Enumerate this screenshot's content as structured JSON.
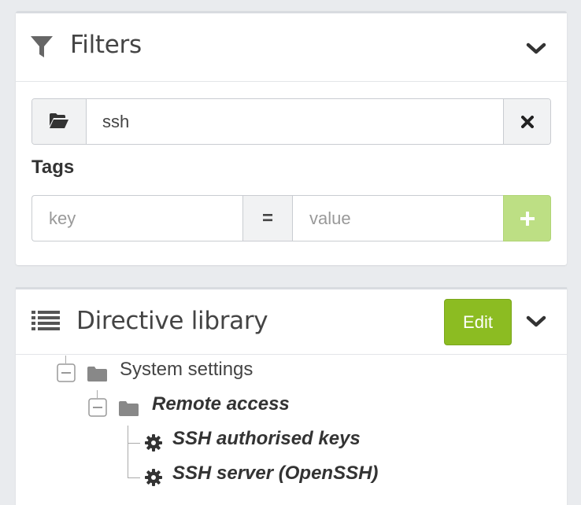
{
  "filters": {
    "title": "Filters",
    "search": {
      "value": "ssh"
    },
    "tags": {
      "label": "Tags",
      "key_placeholder": "key",
      "operator": "=",
      "value_placeholder": "value"
    }
  },
  "library": {
    "title": "Directive library",
    "edit_label": "Edit",
    "tree": {
      "category": "System settings",
      "subcategory": "Remote access",
      "directives": [
        "SSH authorised keys",
        "SSH server (OpenSSH)"
      ]
    }
  },
  "colors": {
    "edit_button": "#8cbc22",
    "add_button": "#bddf84",
    "background": "#e9ebee"
  },
  "icons": [
    "filter-icon",
    "chevron-down-icon",
    "folder-open-icon",
    "close-icon",
    "plus-icon",
    "list-icon",
    "folder-icon",
    "collapse-minus-icon",
    "gear-icon"
  ]
}
